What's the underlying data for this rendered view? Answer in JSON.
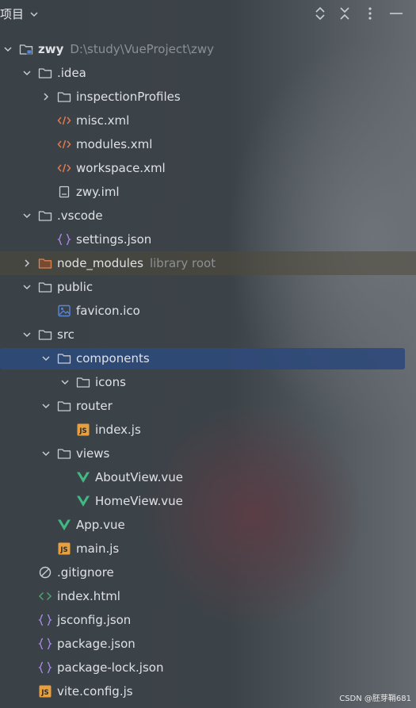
{
  "header": {
    "title": "项目"
  },
  "tree": [
    {
      "name": "zwy",
      "hint": "D:\\study\\VueProject\\zwy",
      "level": 0,
      "arrow": "down",
      "icon": "module-folder-icon",
      "bold": true
    },
    {
      "name": ".idea",
      "level": 1,
      "arrow": "down",
      "icon": "folder-icon"
    },
    {
      "name": "inspectionProfiles",
      "level": 2,
      "arrow": "right",
      "icon": "folder-icon"
    },
    {
      "name": "misc.xml",
      "level": 2,
      "arrow": "",
      "icon": "xml-icon"
    },
    {
      "name": "modules.xml",
      "level": 2,
      "arrow": "",
      "icon": "xml-icon"
    },
    {
      "name": "workspace.xml",
      "level": 2,
      "arrow": "",
      "icon": "xml-icon"
    },
    {
      "name": "zwy.iml",
      "level": 2,
      "arrow": "",
      "icon": "iml-file-icon"
    },
    {
      "name": ".vscode",
      "level": 1,
      "arrow": "down",
      "icon": "folder-icon"
    },
    {
      "name": "settings.json",
      "level": 2,
      "arrow": "",
      "icon": "json-icon"
    },
    {
      "name": "node_modules",
      "hint": "library root",
      "level": 1,
      "arrow": "right",
      "icon": "library-folder-icon",
      "lib": true
    },
    {
      "name": "public",
      "level": 1,
      "arrow": "down",
      "icon": "folder-icon"
    },
    {
      "name": "favicon.ico",
      "level": 2,
      "arrow": "",
      "icon": "image-file-icon"
    },
    {
      "name": "src",
      "level": 1,
      "arrow": "down",
      "icon": "folder-icon"
    },
    {
      "name": "components",
      "level": 2,
      "arrow": "down",
      "icon": "folder-icon",
      "selected": true
    },
    {
      "name": "icons",
      "level": 3,
      "arrow": "down",
      "icon": "folder-icon"
    },
    {
      "name": "router",
      "level": 2,
      "arrow": "down",
      "icon": "folder-icon"
    },
    {
      "name": "index.js",
      "level": 3,
      "arrow": "",
      "icon": "js-icon"
    },
    {
      "name": "views",
      "level": 2,
      "arrow": "down",
      "icon": "folder-icon"
    },
    {
      "name": "AboutView.vue",
      "level": 3,
      "arrow": "",
      "icon": "vue-icon"
    },
    {
      "name": "HomeView.vue",
      "level": 3,
      "arrow": "",
      "icon": "vue-icon"
    },
    {
      "name": "App.vue",
      "level": 2,
      "arrow": "",
      "icon": "vue-icon"
    },
    {
      "name": "main.js",
      "level": 2,
      "arrow": "",
      "icon": "js-icon"
    },
    {
      "name": ".gitignore",
      "level": 1,
      "arrow": "",
      "icon": "gitignore-icon"
    },
    {
      "name": "index.html",
      "level": 1,
      "arrow": "",
      "icon": "html-icon"
    },
    {
      "name": "jsconfig.json",
      "level": 1,
      "arrow": "",
      "icon": "json-icon"
    },
    {
      "name": "package.json",
      "level": 1,
      "arrow": "",
      "icon": "json-icon"
    },
    {
      "name": "package-lock.json",
      "level": 1,
      "arrow": "",
      "icon": "json-icon"
    },
    {
      "name": "vite.config.js",
      "level": 1,
      "arrow": "",
      "icon": "js-icon"
    }
  ],
  "watermark": "CSDN @胚芽鞘681",
  "colors": {
    "selection": "#2f4a7a",
    "folder": "#c9cdd3",
    "xml": "#e0784f",
    "json": "#a98ae8",
    "vue": "#42b883",
    "js": "#e9a03c",
    "html": "#4fa36b"
  }
}
